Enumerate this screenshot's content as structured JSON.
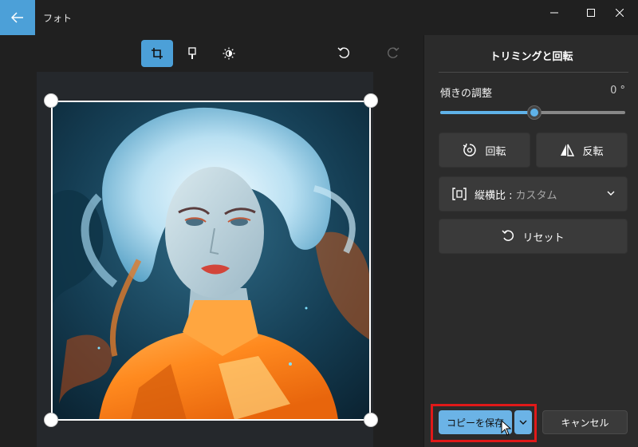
{
  "window": {
    "app_title": "フォト"
  },
  "toolbar": {
    "active_tool": "crop"
  },
  "panel": {
    "title": "トリミングと回転",
    "tilt": {
      "label": "傾きの調整",
      "value_text": "0 °",
      "value": 0,
      "slider_fraction": 0.51
    },
    "rotate_label": "回転",
    "flip_label": "反転",
    "aspect": {
      "label": "縦横比 :",
      "value": "カスタム"
    },
    "reset_label": "リセット"
  },
  "actions": {
    "save_copy_label": "コピーを保存",
    "cancel_label": "キャンセル"
  },
  "colors": {
    "accent": "#4ca0d8",
    "save_button": "#6bb3e6",
    "highlight_box": "#e01919",
    "panel_bg": "#2b2b2b",
    "app_bg": "#202020"
  }
}
